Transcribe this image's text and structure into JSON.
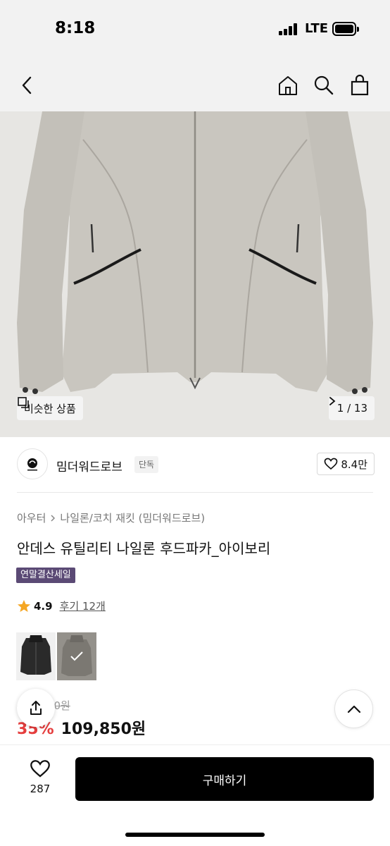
{
  "status": {
    "time": "8:18",
    "network": "LTE"
  },
  "nav": {
    "back_icon": "chevron-left-icon",
    "home_icon": "home-icon",
    "search_icon": "search-icon",
    "cart_icon": "shopping-bag-icon"
  },
  "gallery": {
    "similar_label": "비슷한 상품",
    "counter": "1 / 13"
  },
  "brand": {
    "name": "밈더워드로브",
    "badge": "단독",
    "likes": "8.4만"
  },
  "breadcrumb": [
    "아우터",
    "나일론/코치 재킷 (밈더워드로브)"
  ],
  "product": {
    "title": "안데스 유틸리티 나일론 후드파카_아이보리",
    "sale_badge": "연말결산세일",
    "rating": "4.9",
    "reviews": "후기 12개",
    "original_price": "169,000원",
    "discount": "35%",
    "price": "109,850원"
  },
  "bottom": {
    "wish_count": "287",
    "buy_label": "구매하기"
  },
  "colors": {
    "accent": "#e53e3e",
    "badge": "#5b4a75",
    "star": "#f5a623"
  }
}
